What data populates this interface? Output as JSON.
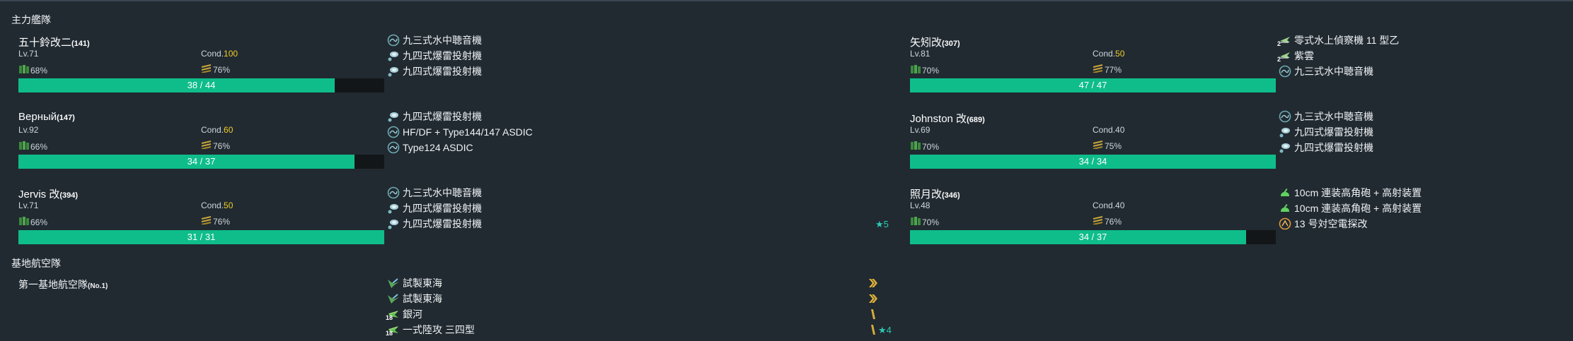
{
  "main_fleet_title": "主力艦隊",
  "ships": [
    {
      "name": "五十鈴改二",
      "id": "(141)",
      "lv": "Lv.71",
      "cond_label": "Cond.",
      "cond": "100",
      "cond_high": true,
      "fuel": "68%",
      "ammo": "76%",
      "hp": "38 / 44",
      "hp_ratio": 0.864,
      "equips": [
        {
          "icon": "sonar-icon",
          "name": "九三式水中聴音機"
        },
        {
          "icon": "depth-charge-icon",
          "name": "九四式爆雷投射機"
        },
        {
          "icon": "depth-charge-icon",
          "name": "九四式爆雷投射機"
        }
      ]
    },
    {
      "name": "Верный",
      "id": "(147)",
      "lv": "Lv.92",
      "cond_label": "Cond.",
      "cond": "60",
      "cond_high": true,
      "fuel": "66%",
      "ammo": "76%",
      "hp": "34 / 37",
      "hp_ratio": 0.919,
      "equips": [
        {
          "icon": "depth-charge-icon",
          "name": "九四式爆雷投射機"
        },
        {
          "icon": "sonar-icon",
          "name": "HF/DF + Type144/147 ASDIC"
        },
        {
          "icon": "sonar-icon",
          "name": "Type124 ASDIC"
        }
      ]
    },
    {
      "name": "Jervis 改",
      "id": "(394)",
      "lv": "Lv.71",
      "cond_label": "Cond.",
      "cond": "50",
      "cond_high": true,
      "fuel": "66%",
      "ammo": "76%",
      "hp": "31 / 31",
      "hp_ratio": 1.0,
      "equips": [
        {
          "icon": "sonar-icon",
          "name": "九三式水中聴音機"
        },
        {
          "icon": "depth-charge-icon",
          "name": "九四式爆雷投射機"
        },
        {
          "icon": "depth-charge-icon",
          "name": "九四式爆雷投射機",
          "star": "★5"
        }
      ]
    },
    {
      "name": "矢矧改",
      "id": "(307)",
      "lv": "Lv.81",
      "cond_label": "Cond.",
      "cond": "50",
      "cond_high": true,
      "fuel": "70%",
      "ammo": "77%",
      "hp": "47 / 47",
      "hp_ratio": 1.0,
      "equips": [
        {
          "icon": "seaplane-recon-icon",
          "name": "零式水上偵察機 11 型乙",
          "badge": "2"
        },
        {
          "icon": "seaplane-recon-icon",
          "name": "紫雲",
          "badge": "2"
        },
        {
          "icon": "sonar-icon",
          "name": "九三式水中聴音機"
        }
      ]
    },
    {
      "name": "Johnston 改",
      "id": "(689)",
      "lv": "Lv.69",
      "cond_label": "Cond.",
      "cond": "40",
      "cond_high": false,
      "fuel": "70%",
      "ammo": "75%",
      "hp": "34 / 34",
      "hp_ratio": 1.0,
      "equips": [
        {
          "icon": "sonar-icon",
          "name": "九三式水中聴音機"
        },
        {
          "icon": "depth-charge-icon",
          "name": "九四式爆雷投射機"
        },
        {
          "icon": "depth-charge-icon",
          "name": "九四式爆雷投射機"
        }
      ]
    },
    {
      "name": "照月改",
      "id": "(346)",
      "lv": "Lv.48",
      "cond_label": "Cond.",
      "cond": "40",
      "cond_high": false,
      "fuel": "70%",
      "ammo": "76%",
      "hp": "34 / 37",
      "hp_ratio": 0.919,
      "equips": [
        {
          "icon": "high-angle-gun-icon",
          "name": "10cm 連装高角砲 + 高射装置"
        },
        {
          "icon": "high-angle-gun-icon",
          "name": "10cm 連装高角砲 + 高射装置"
        },
        {
          "icon": "radar-icon",
          "name": "13 号対空電探改"
        }
      ]
    }
  ],
  "land_base_title": "基地航空隊",
  "land_base": {
    "name": "第一基地航空隊",
    "id": "(No.1)",
    "planes": [
      {
        "icon": "land-fighter-icon",
        "name": "試製東海",
        "prof": "double-chevron"
      },
      {
        "icon": "land-fighter-icon",
        "name": "試製東海",
        "prof": "double-chevron"
      },
      {
        "icon": "land-bomber-icon",
        "name": "銀河",
        "badge": "18",
        "prof": "single-bar"
      },
      {
        "icon": "land-bomber-icon",
        "name": "一式陸攻 三四型",
        "badge": "18",
        "prof": "single-bar",
        "star": "★4"
      }
    ]
  },
  "colors": {
    "hp_fill": "#0fbd8b",
    "cond_high": "#f0cc2a",
    "star": "#2ec9b3",
    "background": "#212a31"
  }
}
